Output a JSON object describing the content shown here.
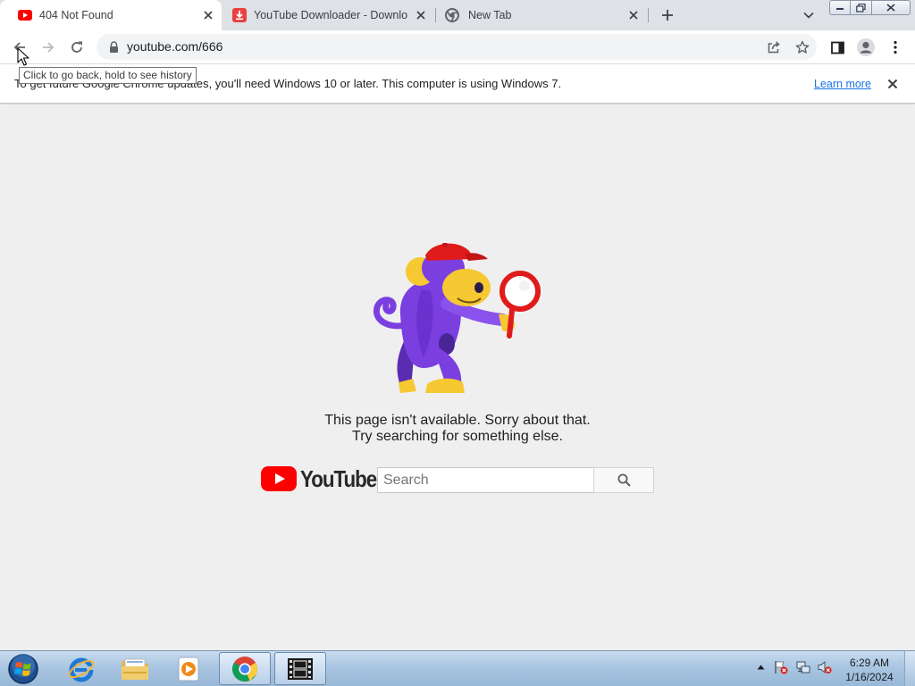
{
  "tabs": [
    {
      "title": "404 Not Found",
      "favicon": "youtube-favicon",
      "active": true
    },
    {
      "title": "YouTube Downloader - Download",
      "favicon": "downloader-favicon",
      "active": false
    },
    {
      "title": "New Tab",
      "favicon": "chrome-favicon",
      "active": false
    }
  ],
  "toolbar": {
    "url": "youtube.com/666",
    "tooltip": "Click to go back, hold to see history"
  },
  "infobar": {
    "message": "To get future Google Chrome updates, you'll need Windows 10 or later. This computer is using Windows 7.",
    "link": "Learn more"
  },
  "page": {
    "message_line1": "This page isn't available. Sorry about that.",
    "message_line2": "Try searching for something else.",
    "logo_text": "YouTube",
    "search_placeholder": "Search"
  },
  "taskbar": {
    "apps": [
      "start-orb",
      "internet-explorer",
      "file-explorer",
      "media-player",
      "google-chrome",
      "video-editor"
    ],
    "time": "6:29 AM",
    "date": "1/16/2024"
  },
  "colors": {
    "youtube_red": "#ff0000",
    "link_blue": "#1a73e8",
    "monkey_purple": "#7b3fe0",
    "monkey_yellow": "#f6c832"
  }
}
